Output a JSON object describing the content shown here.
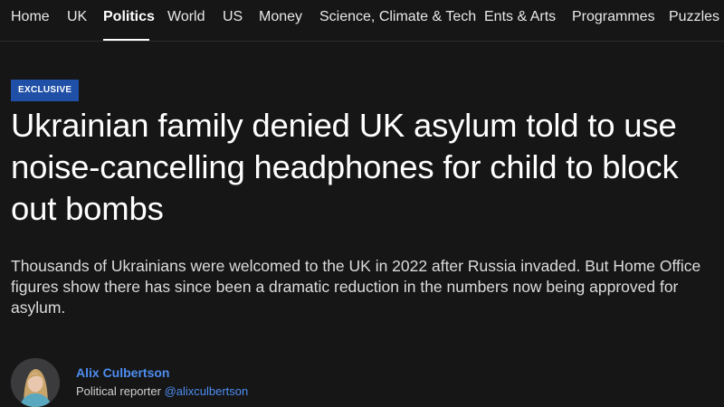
{
  "nav": {
    "items": [
      {
        "label": "Home"
      },
      {
        "label": "UK"
      },
      {
        "label": "Politics",
        "active": true
      },
      {
        "label": "World"
      },
      {
        "label": "US"
      },
      {
        "label": "Money"
      },
      {
        "label": "Science, Climate & Tech"
      },
      {
        "label": "Ents & Arts"
      },
      {
        "label": "Programmes"
      },
      {
        "label": "Puzzles"
      }
    ]
  },
  "article": {
    "badge": "EXCLUSIVE",
    "headline": "Ukrainian family denied UK asylum told to use noise-cancelling headphones for child to block out bombs",
    "standfirst": "Thousands of Ukrainians were welcomed to the UK in 2022 after Russia invaded. But Home Office figures show there has since been a dramatic reduction in the numbers now being approved for asylum."
  },
  "author": {
    "name": "Alix Culbertson",
    "role": "Political reporter",
    "handle": "@alixculbertson"
  },
  "colors": {
    "background": "#161616",
    "badge": "#1f4fa6",
    "link": "#4d8df0"
  }
}
